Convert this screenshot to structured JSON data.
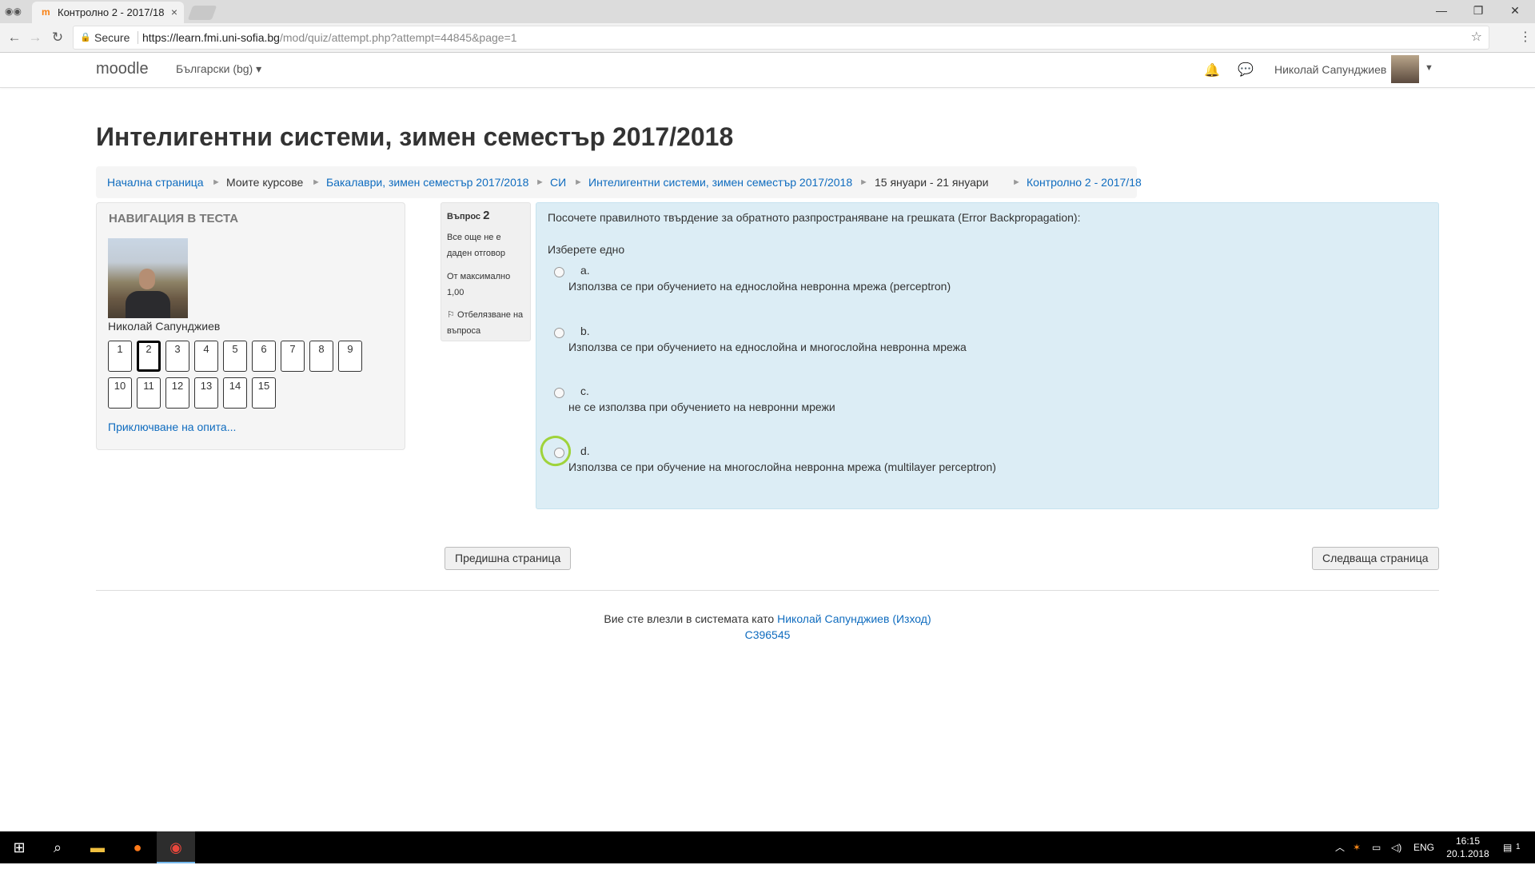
{
  "browser": {
    "tab_title": "Контролно 2 - 2017/18",
    "tab_close": "×",
    "secure_label": "Secure",
    "url_host": "https://learn.fmi.uni-sofia.bg",
    "url_path": "/mod/quiz/attempt.php?attempt=44845&page=1"
  },
  "header": {
    "brand": "moodle",
    "language": "Български (bg) ▾",
    "user_name": "Николай Сапунджиев"
  },
  "page": {
    "title": "Интелигентни системи, зимен семестър 2017/2018",
    "breadcrumb": [
      {
        "label": "Начална страница",
        "link": true
      },
      {
        "label": "Моите курсове",
        "link": false
      },
      {
        "label": "Бакалаври, зимен семестър 2017/2018",
        "link": true
      },
      {
        "label": "СИ",
        "link": true
      },
      {
        "label": "Интелигентни системи, зимен семестър 2017/2018",
        "link": true
      },
      {
        "label": "15 януари - 21 януари",
        "link": false
      },
      {
        "label": "Контролно 2 - 2017/18",
        "link": true
      }
    ]
  },
  "quiz_nav": {
    "heading": "НАВИГАЦИЯ В ТЕСТА",
    "user_name": "Николай Сапунджиев",
    "questions": [
      "1",
      "2",
      "3",
      "4",
      "5",
      "6",
      "7",
      "8",
      "9",
      "10",
      "11",
      "12",
      "13",
      "14",
      "15"
    ],
    "current": "2",
    "finish_link": "Приключване на опита..."
  },
  "question": {
    "label": "Въпрос",
    "number": "2",
    "status": "Все още не е даден отговор",
    "mark": "От максимално 1,00",
    "flag": "Отбелязване на въпроса",
    "text": "Посочете правилното твърдение за обратното разпространяване на грешката (Error Backpropagation):",
    "prompt": "Изберете едно",
    "options": [
      {
        "letter": "a.",
        "text": "Използва се при обучението на еднослойна невронна мрежа (perceptron)"
      },
      {
        "letter": "b.",
        "text": "Използва се при обучението на еднослойна и многослойна невронна мрежа"
      },
      {
        "letter": "c.",
        "text": "не се използва при обучението на невронни мрежи"
      },
      {
        "letter": "d.",
        "text": "Използва се при обучение на многослойна невронна мрежа (multilayer perceptron)"
      }
    ]
  },
  "nav_buttons": {
    "previous": "Предишна страница",
    "next": "Следваща страница"
  },
  "footer": {
    "logged_in_text": "Вие сте влезли в системата като",
    "user_link": "Николай Сапунджиев",
    "logout_link": "(Изход)",
    "code": "C396545"
  },
  "taskbar": {
    "lang": "ENG",
    "time": "16:15",
    "date": "20.1.2018 г.",
    "notif_count": "1"
  },
  "colors": {
    "link": "#0f6cbf",
    "question_bg": "#dcedf5",
    "highlight_ring": "#9fd33b"
  }
}
